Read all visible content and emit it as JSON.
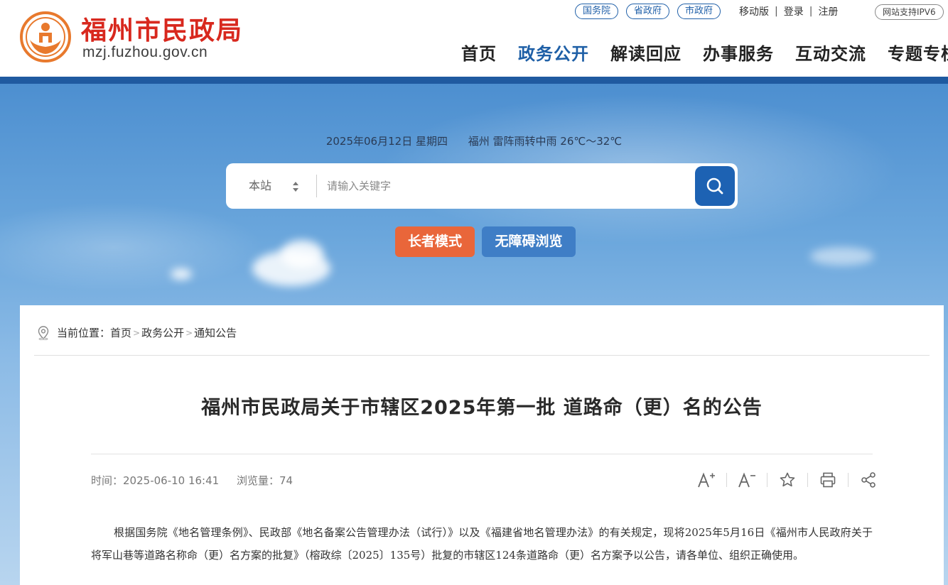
{
  "header": {
    "site_title": "福州市民政局",
    "site_domain": "mzj.fuzhou.gov.cn",
    "gov_links": [
      {
        "label": "国务院"
      },
      {
        "label": "省政府"
      },
      {
        "label": "市政府"
      }
    ],
    "util_links": {
      "mobile": "移动版",
      "login": "登录",
      "register": "注册"
    },
    "ipv6_badge": "网站支持IPV6",
    "nav": [
      {
        "label": "首页"
      },
      {
        "label": "政务公开",
        "active": true
      },
      {
        "label": "解读回应"
      },
      {
        "label": "办事服务"
      },
      {
        "label": "互动交流"
      },
      {
        "label": "专题专栏"
      }
    ],
    "brand_color": "#d8281e",
    "nav_active_color": "#1e5fa6"
  },
  "banner": {
    "date": "2025年06月12日 星期四",
    "weather": "福州 雷阵雨转中雨 26℃～32℃",
    "search": {
      "scope": "本站",
      "placeholder": "请输入关键字",
      "button_icon": "search-icon"
    },
    "elder_mode": "长者模式",
    "accessibility": "无障碍浏览"
  },
  "breadcrumb": {
    "prefix": "当前位置：",
    "items": [
      "首页",
      "政务公开",
      "通知公告"
    ]
  },
  "article": {
    "title": "福州市民政局关于市辖区2025年第一批 道路命（更）名的公告",
    "time_label": "时间：",
    "time": "2025-06-10 16:41",
    "views_label": "浏览量：",
    "views": "74",
    "tools": [
      "font-increase-icon",
      "font-decrease-icon",
      "star-icon",
      "print-icon",
      "share-icon"
    ],
    "body": "根据国务院《地名管理条例》、民政部《地名备案公告管理办法（试行）》以及《福建省地名管理办法》的有关规定，现将2025年5月16日《福州市人民政府关于将军山巷等道路名称命（更）名方案的批复》（榕政综〔2025〕135号）批复的市辖区124条道路命（更）名方案予以公告，请各单位、组织正确使用。"
  }
}
